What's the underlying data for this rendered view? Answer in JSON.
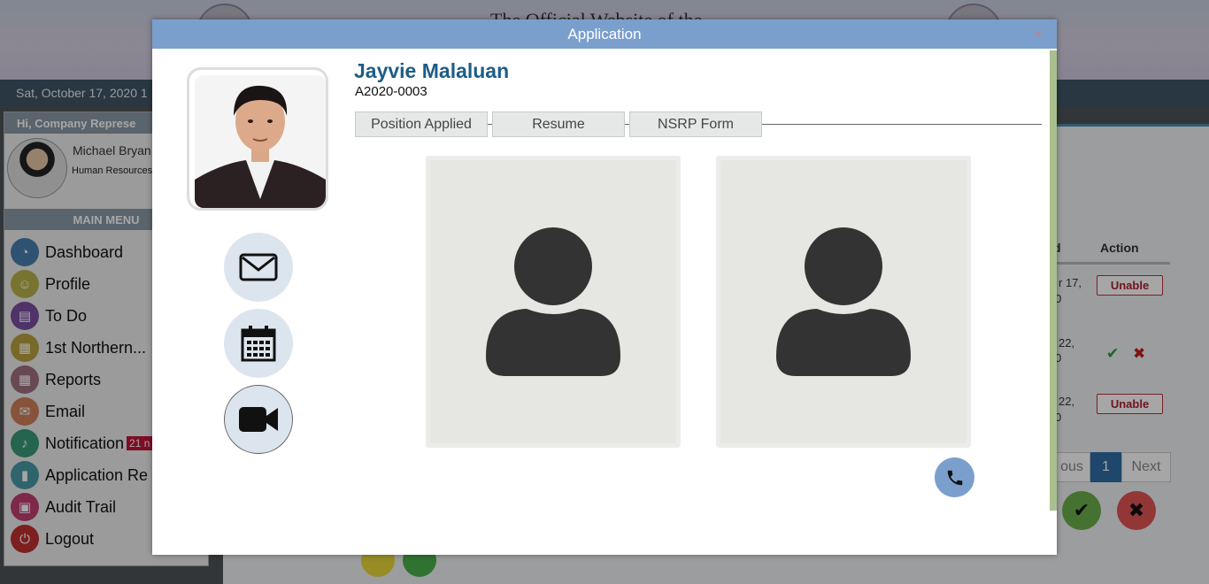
{
  "background": {
    "header_title": "The Official Website of the",
    "date_text": "Sat, October 17, 2020 1",
    "greeting": "Hi, Company Represe",
    "user_name": "Michael Bryan",
    "user_role": "Human Resources",
    "menu_header": "MAIN MENU",
    "menu": [
      {
        "label": "Dashboard",
        "icon": "dashboard-icon",
        "color": "#4a7fb0"
      },
      {
        "label": "Profile",
        "icon": "profile-icon",
        "color": "#b8b24a"
      },
      {
        "label": "To Do",
        "icon": "todo-icon",
        "color": "#7a4fa0"
      },
      {
        "label": "1st Northern...",
        "icon": "building-icon",
        "color": "#b8a040"
      },
      {
        "label": "Reports",
        "icon": "reports-icon",
        "color": "#a07080"
      },
      {
        "label": "Email",
        "icon": "email-icon",
        "color": "#d0805a"
      },
      {
        "label": "Notification",
        "icon": "bell-icon",
        "color": "#3a9a7a",
        "badge": "21 n"
      },
      {
        "label": "Application Re",
        "icon": "bookmark-icon",
        "color": "#4a9aa8"
      },
      {
        "label": "Audit Trail",
        "icon": "audit-icon",
        "color": "#c04070"
      },
      {
        "label": "Logout",
        "icon": "power-icon",
        "color": "#c03030"
      }
    ],
    "table": {
      "col_partial": "d",
      "col_action": "Action",
      "rows": [
        {
          "date_a": "r 17,",
          "date_b": "0",
          "action": "Unable"
        },
        {
          "date_a": "22,",
          "date_b": "0",
          "action": "check-cross"
        },
        {
          "date_a": "22,",
          "date_b": "0",
          "action": "Unable"
        }
      ]
    },
    "pager": {
      "prev": "ous",
      "current": "1",
      "next": "Next"
    }
  },
  "modal": {
    "title": "Application",
    "close": "×",
    "applicant_name": "Jayvie Malaluan",
    "applicant_id": "A2020-0003",
    "tabs": [
      "Position Applied",
      "Resume",
      "NSRP Form"
    ],
    "actions": [
      {
        "name": "email-icon"
      },
      {
        "name": "calendar-icon"
      },
      {
        "name": "video-camera-icon"
      }
    ],
    "accent": "#7b9fcd",
    "name_color": "#1d5d86"
  }
}
